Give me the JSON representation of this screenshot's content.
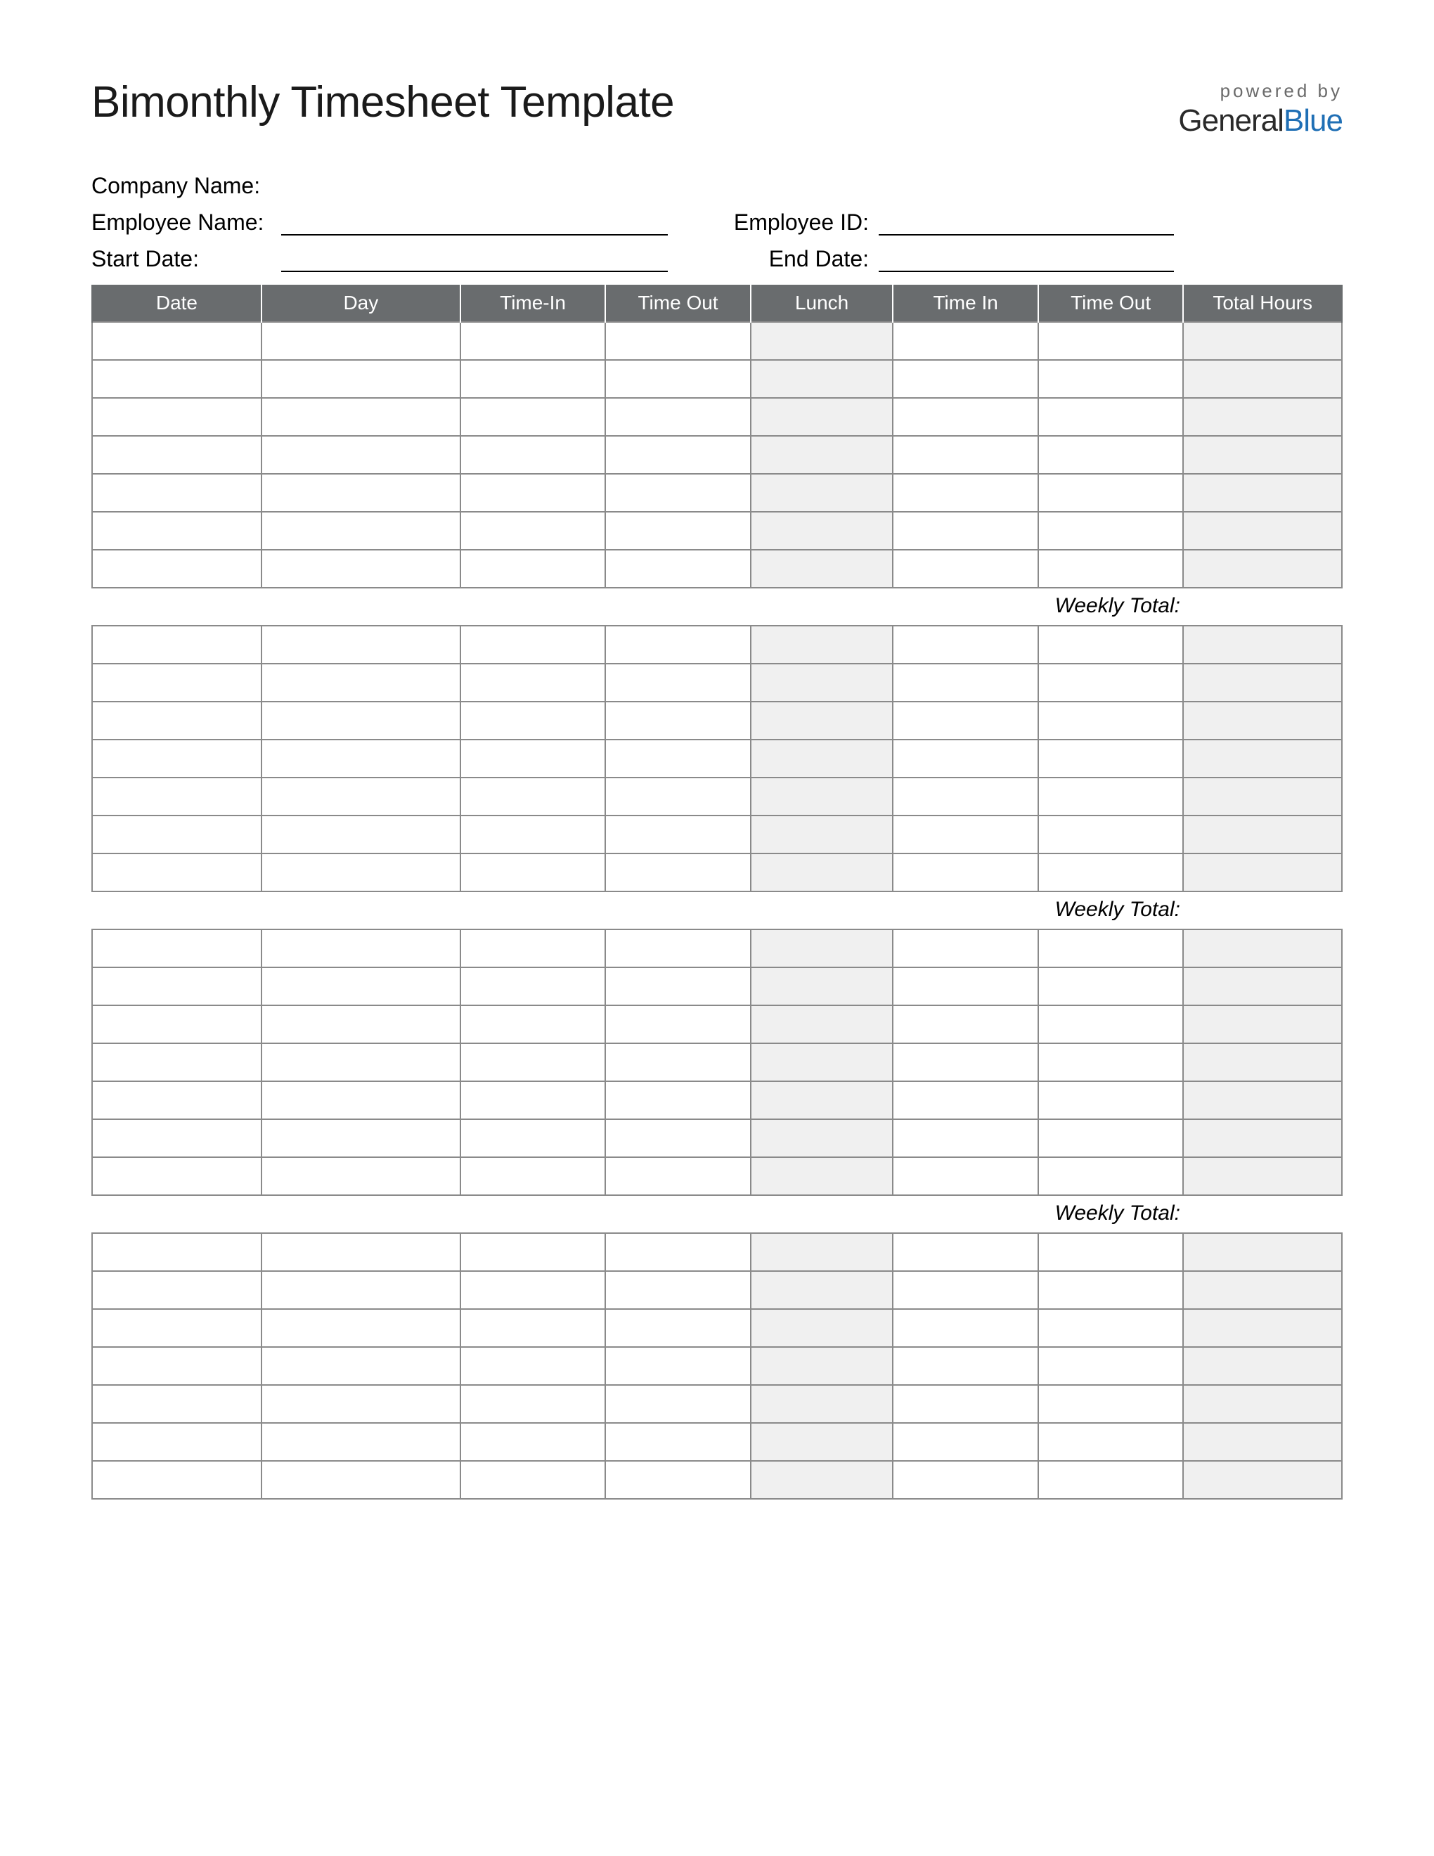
{
  "title": "Bimonthly Timesheet Template",
  "branding": {
    "powered_by": "powered by",
    "logo_part1": "General",
    "logo_part2": "Blue"
  },
  "info": {
    "company_label": "Company Name:",
    "employee_label": "Employee Name:",
    "employee_id_label": "Employee ID:",
    "start_date_label": "Start Date:",
    "end_date_label": "End Date:"
  },
  "columns": [
    "Date",
    "Day",
    "Time-In",
    "Time Out",
    "Lunch",
    "Time In",
    "Time Out",
    "Total Hours"
  ],
  "weekly_total_label": "Weekly Total:",
  "weeks": [
    {
      "rows": 7
    },
    {
      "rows": 7
    },
    {
      "rows": 7
    },
    {
      "rows": 7
    }
  ]
}
